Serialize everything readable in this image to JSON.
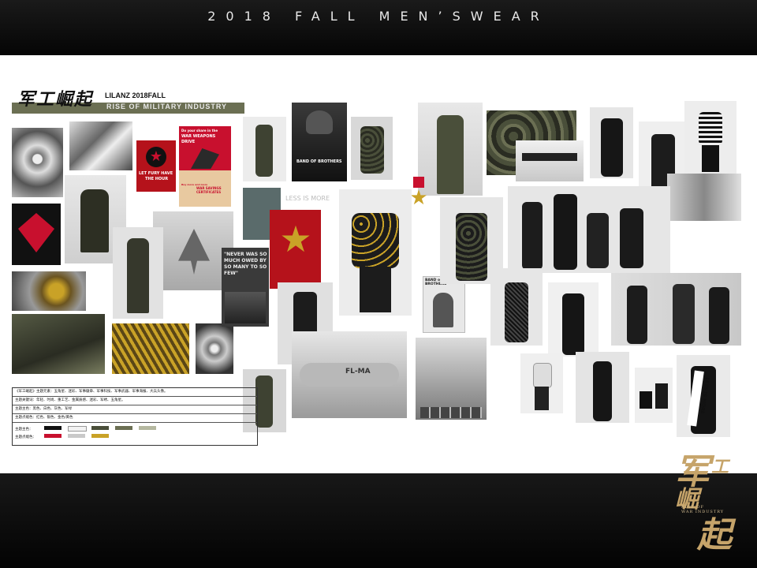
{
  "header": {
    "title": "2018 FALL MEN’SWEAR"
  },
  "theme": {
    "title_cn": "军工崛起",
    "brand_line": "LILANZ 2018FALL",
    "subtitle": "RISE OF MILITARY INDUSTRY"
  },
  "posters": {
    "fury_line1": "LET FURY HAVE",
    "fury_line2": "THE HOUR",
    "war_weapons_top": "Do your share in the",
    "war_weapons_main": "WAR WEAPONS DRIVE",
    "war_savings": "WAR SAVINGS CERTIFICATES",
    "war_savings_small": "Buy more and more",
    "quote": "\"NEVER WAS SO MUCH OWED BY SO MANY TO SO FEW\"",
    "less_is_more": "LESS IS MORE",
    "band_of_brothers": "BAND OF BROTHERS",
    "band_of_brothers_2": "BAND of BROTHERS",
    "plane_livery": "FL-MA",
    "sash_text": "LESS IS MORE"
  },
  "legend": {
    "rows": [
      "《军工崛起》主题元素：五角星、迷彩、军事徽章、军事科技、军事武器、军事海报、大兵头像。",
      "主题关键词：年轻、时尚、重工艺、金属质感、迷彩、军绣、五角星。",
      "主题主色：黑色、白色、灰色、军绿",
      "主题点缀色：红色、银色、金色/黄色"
    ],
    "main_color_label": "主题主色：",
    "accent_color_label": "主题点缀色：",
    "main_colors": [
      "#111111",
      "#f2f2f2",
      "#4a4f3a",
      "#6b6f53",
      "#b5b8a0"
    ],
    "accent_colors": [
      "#c8102e",
      "#c9c9c9",
      "#c9a227"
    ]
  },
  "brand": {
    "char1": "军",
    "char2": "工",
    "char3": "崛",
    "char4": "起",
    "en_line1": "RISE OF",
    "en_line2": "WAR INDUSTRY"
  },
  "colors": {
    "accent_red": "#c8102e",
    "olive": "#4a4f3a",
    "gold": "#c9a227",
    "background": "#0b0b0b"
  }
}
